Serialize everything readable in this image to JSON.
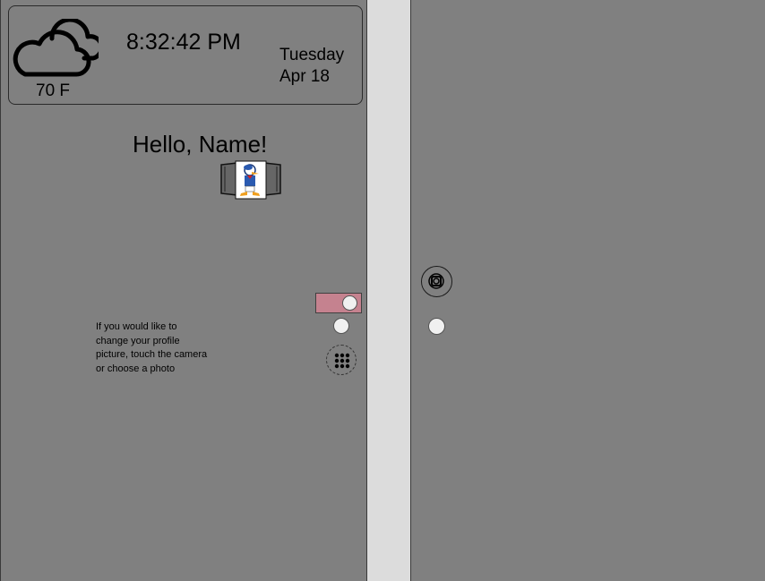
{
  "weather": {
    "temperature": "70 F",
    "time": "8:32:42 PM",
    "day": "Tuesday",
    "date": "Apr 18",
    "icon": "cloud-icon"
  },
  "greeting": "Hello, Name!",
  "profile": {
    "hint": "If you would like to change your profile picture, touch the camera or choose a photo",
    "icon": "photo-album-icon"
  },
  "controls": {
    "toggle_color": "#c5828f",
    "grid_icon": "app-grid-icon",
    "camera_icon": "camera-icon"
  }
}
